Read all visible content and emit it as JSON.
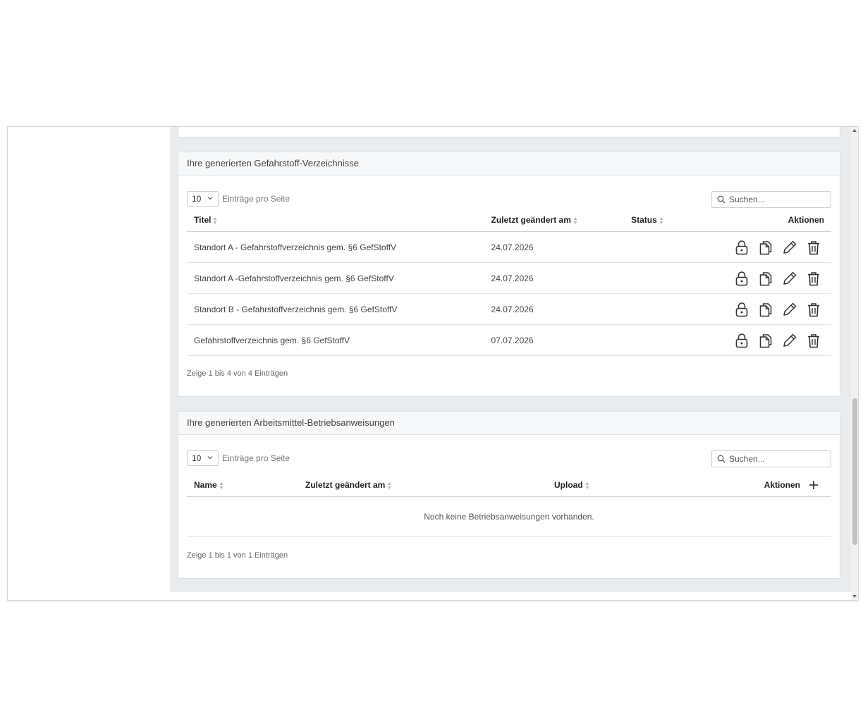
{
  "section1": {
    "header": "Ihre generierten Gefahrstoff-Verzeichnisse",
    "page_length": "10",
    "page_length_label": "Einträge pro Seite",
    "search_placeholder": "Suchen...",
    "columns": {
      "title": "Titel",
      "modified": "Zuletzt geändert am",
      "status": "Status",
      "actions": "Aktionen"
    },
    "rows": [
      {
        "title": "Standort A - Gefahrstoffverzeichnis gem. §6 GefStoffV",
        "modified": "24.07.2026",
        "status": ""
      },
      {
        "title": "Standort A -Gefahrstoffverzeichnis gem. §6 GefStoffV",
        "modified": "24.07.2026",
        "status": ""
      },
      {
        "title": "Standort B - Gefahrstoffverzeichnis gem. §6 GefStoffV",
        "modified": "24.07.2026",
        "status": ""
      },
      {
        "title": "Gefahrstoffverzeichnis gem. §6 GefStoffV",
        "modified": "07.07.2026",
        "status": ""
      }
    ],
    "info": "Zeige 1 bis 4 von 4 Einträgen"
  },
  "section2": {
    "header": "Ihre generierten Arbeitsmittel-Betriebsanweisungen",
    "page_length": "10",
    "page_length_label": "Einträge pro Seite",
    "search_placeholder": "Suchen...",
    "columns": {
      "name": "Name",
      "modified": "Zuletzt geändert am",
      "upload": "Upload",
      "actions": "Aktionen"
    },
    "empty_message": "Noch keine Betriebsanweisungen vorhanden.",
    "info": "Zeige 1 bis 1 von 1 Einträgen"
  },
  "icons": {
    "row_actions": [
      "lock-icon",
      "copy-icon",
      "edit-icon",
      "trash-icon"
    ],
    "add": "plus-icon",
    "search": "search-icon"
  }
}
